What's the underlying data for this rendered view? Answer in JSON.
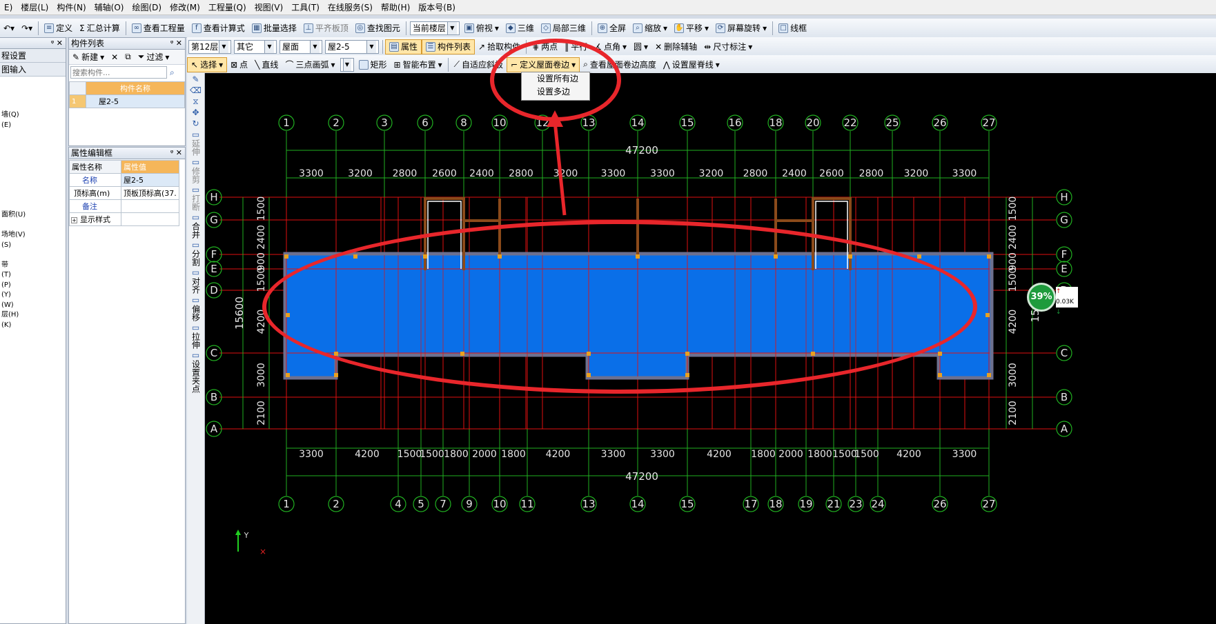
{
  "menu": [
    "E)",
    "楼层(L)",
    "构件(N)",
    "辅轴(O)",
    "绘图(D)",
    "修改(M)",
    "工程量(Q)",
    "视图(V)",
    "工具(T)",
    "在线服务(S)",
    "帮助(H)",
    "版本号(B)"
  ],
  "toolbar1": {
    "define": "定义",
    "sum": "汇总计算",
    "view_qty": "查看工程量",
    "view_formula": "查看计算式",
    "batch_select": "批量选择",
    "level_top": "平齐板顶",
    "find": "查找图元",
    "floor_combo": "当前楼层",
    "top_view": "俯视",
    "three_d": "三维",
    "local_3d": "局部三维",
    "full_screen": "全屏",
    "zoom": "缩放",
    "pan": "平移",
    "rotate": "屏幕旋转",
    "wireframe": "线框"
  },
  "toolbar2": {
    "floor": "第12层",
    "category": "其它",
    "type": "屋面",
    "component": "屋2-5",
    "property": "属性",
    "component_list": "构件列表",
    "pick": "拾取构件",
    "two_points": "两点",
    "parallel": "平行",
    "point_angle": "点角",
    "circle": "圆",
    "delete_aux": "删除辅轴",
    "dimension": "尺寸标注"
  },
  "toolbar3": {
    "select": "选择",
    "point": "点",
    "line": "直线",
    "arc": "三点画弧",
    "rect": "矩形",
    "smart": "智能布置",
    "adapt_slab": "自适应斜板",
    "define_roll": "定义屋面卷边",
    "view_roll": "查看屋面卷边高度",
    "ridge": "设置屋脊线"
  },
  "dropdown": {
    "all_edges": "设置所有边",
    "multi_edges": "设置多边"
  },
  "left_nav": {
    "items": [
      "程设置",
      "图输入",
      "",
      "",
      "",
      "墙(Q)",
      "(E)",
      "",
      "",
      "",
      "",
      "",
      "",
      "",
      "",
      "面积(U)",
      "",
      "场地(V)",
      "(S)",
      "",
      "带",
      "(T)",
      "(P)",
      "(Y)",
      "(W)",
      "层(H)",
      "(K)"
    ]
  },
  "component_list": {
    "title": "构件列表",
    "new": "新建",
    "filter": "过滤",
    "search_placeholder": "搜索构件...",
    "col_header": "构件名称",
    "rows": [
      {
        "idx": "1",
        "name": "屋2-5"
      }
    ]
  },
  "properties": {
    "title": "属性编辑框",
    "col_name": "属性名称",
    "col_value": "属性值",
    "rows": [
      {
        "name": "名称",
        "value": "屋2-5"
      },
      {
        "name": "顶标高(m)",
        "value": "顶板顶标高(37."
      },
      {
        "name": "备注",
        "value": ""
      },
      {
        "name": "显示样式",
        "value": ""
      }
    ]
  },
  "side_tools": [
    "延伸",
    "修剪",
    "打断",
    "合并",
    "分割",
    "对齐",
    "偏移",
    "拉伸",
    "设置夹点"
  ],
  "status_widget": {
    "percent": "39%",
    "up": "0.03K",
    "down": "163K"
  },
  "drawing": {
    "top_axes": [
      "1",
      "2",
      "3",
      "6",
      "8",
      "10",
      "12",
      "13",
      "14",
      "15",
      "16",
      "18",
      "20",
      "22",
      "25",
      "26",
      "27"
    ],
    "bottom_axes": [
      "1",
      "2",
      "4",
      "5",
      "7",
      "9",
      "10",
      "11",
      "13",
      "14",
      "15",
      "17",
      "18",
      "19",
      "21",
      "23",
      "24",
      "26",
      "27"
    ],
    "row_axes": [
      "H",
      "G",
      "F",
      "E",
      "D",
      "C",
      "B",
      "A"
    ],
    "top_total": "47200",
    "top_dims": [
      "3300",
      "3200",
      "2800",
      "2600",
      "2400",
      "2800",
      "3200",
      "3300",
      "3300",
      "3200",
      "2800",
      "2400",
      "2600",
      "2800",
      "3200",
      "3300"
    ],
    "bottom_total": "47200",
    "bottom_dims": [
      "3300",
      "4200",
      "1500",
      "1500",
      "1800",
      "2000",
      "1800",
      "4200",
      "3300",
      "3300",
      "4200",
      "1800",
      "2000",
      "1800",
      "1500",
      "1500",
      "4200",
      "3300"
    ],
    "left_total": "15600",
    "left_dims": [
      "1500",
      "2400",
      "900",
      "1500",
      "4200",
      "3000",
      "2100"
    ],
    "right_dims": [
      "1500",
      "2400",
      "900",
      "1500",
      "4200",
      "3000",
      "2100"
    ],
    "right_total": "15",
    "ucs_y": "Y"
  },
  "colors": {
    "roof_fill": "#0a6fe8",
    "grid_red": "#e01010",
    "axis_green": "#21b021",
    "dim_text": "#e6e6e6"
  }
}
